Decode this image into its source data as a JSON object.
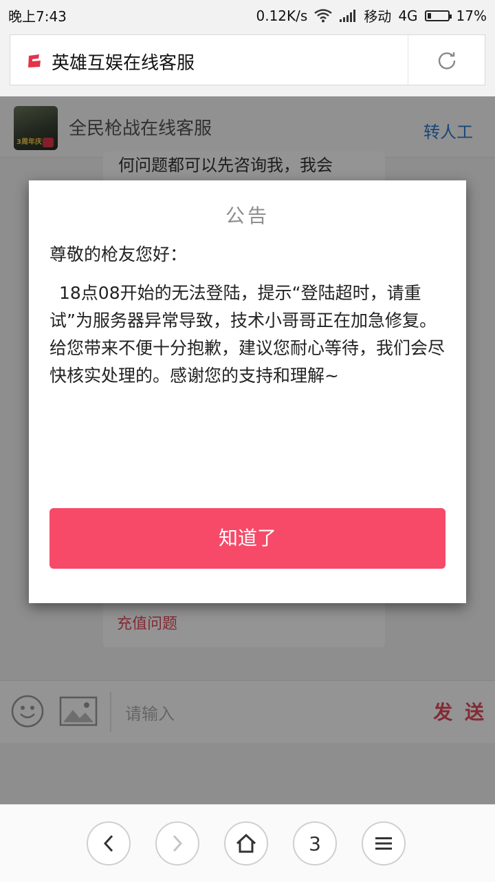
{
  "status_bar": {
    "time": "晚上7:43",
    "net_speed": "0.12K/s",
    "carrier": "移动",
    "network": "4G",
    "battery": "17%",
    "battery_level": 0.17
  },
  "browser": {
    "page_title": "英雄互娱在线客服",
    "tab_count": "3"
  },
  "chat": {
    "title": "全民枪战在线客服",
    "transfer": "转人工",
    "partial_line": "何问题都可以先咨询我，我会",
    "recharge": "充值问题",
    "input_placeholder": "请输入",
    "send": "发 送",
    "avatar_badge": "3周年庆"
  },
  "modal": {
    "title": "公告",
    "greeting": "尊敬的枪友您好：",
    "body": "18点08开始的无法登陆，提示“登陆超时，请重试”为服务器异常导致，技术小哥哥正在加急修复。给您带来不便十分抱歉，建议您耐心等待，我们会尽快核实处理的。感谢您的支持和理解~",
    "button": "知道了"
  },
  "colors": {
    "accent": "#f64a68",
    "link": "#2c7bd1",
    "send": "#e24a5c"
  },
  "icons": [
    "wifi-icon",
    "signal-icon",
    "battery-icon",
    "site-logo-icon",
    "refresh-icon",
    "emoji-icon",
    "image-icon",
    "back-icon",
    "forward-icon",
    "home-icon",
    "menu-icon"
  ]
}
